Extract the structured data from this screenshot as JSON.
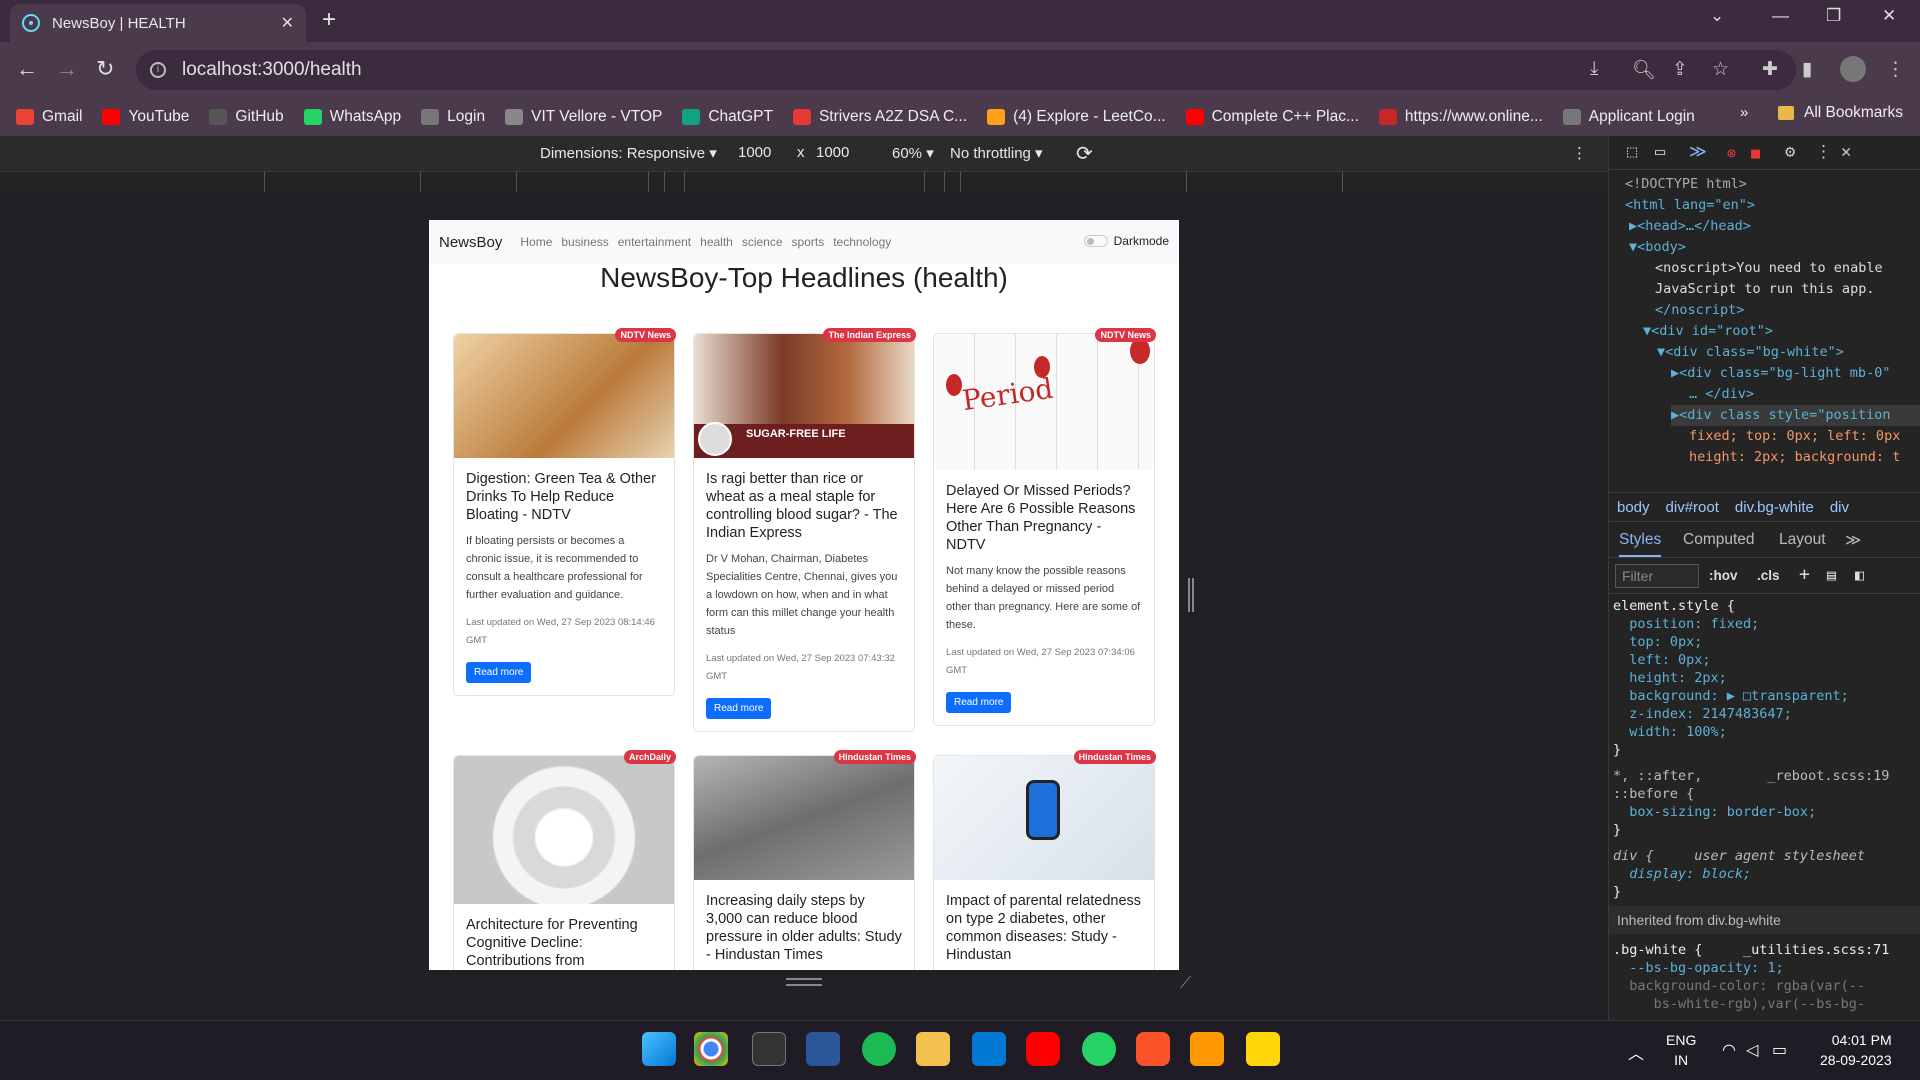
{
  "browser": {
    "tab_title": "NewsBoy | HEALTH",
    "url": "localhost:3000/health"
  },
  "bookmarks": [
    {
      "label": "Gmail",
      "color": "#ea4335"
    },
    {
      "label": "YouTube",
      "color": "#ff0000"
    },
    {
      "label": "GitHub",
      "color": "#555555"
    },
    {
      "label": "WhatsApp",
      "color": "#25d366"
    },
    {
      "label": "Login",
      "color": "#777777"
    },
    {
      "label": "VIT Vellore - VTOP",
      "color": "#888888"
    },
    {
      "label": "ChatGPT",
      "color": "#10a37f"
    },
    {
      "label": "Strivers A2Z DSA C...",
      "color": "#e53935"
    },
    {
      "label": "(4) Explore - LeetCo...",
      "color": "#ffa116"
    },
    {
      "label": "Complete C++ Plac...",
      "color": "#ff0000"
    },
    {
      "label": "https://www.online...",
      "color": "#c62828"
    },
    {
      "label": "Applicant Login",
      "color": "#777777"
    }
  ],
  "all_bookmarks": "All Bookmarks",
  "device_toolbar": {
    "dimensions": "Dimensions: Responsive",
    "width": "1000",
    "times": "x",
    "height": "1000",
    "zoom": "60%",
    "throttling": "No throttling"
  },
  "site": {
    "brand": "NewsBoy",
    "nav": [
      "Home",
      "business",
      "entertainment",
      "health",
      "science",
      "sports",
      "technology"
    ],
    "darkmode": "Darkmode",
    "headline": "NewsBoy-Top Headlines (health)",
    "read_more": "Read more",
    "articles": [
      {
        "source": "NDTV News",
        "title": "Digestion: Green Tea & Other Drinks To Help Reduce Bloating - NDTV",
        "desc": "If bloating persists or becomes a chronic issue, it is recommended to consult a healthcare professional for further evaluation and guidance.",
        "updated": "Last updated on Wed, 27 Sep 2023 08:14:46 GMT",
        "img": "#d8b28a"
      },
      {
        "source": "The Indian Express",
        "title": "Is ragi better than rice or wheat as a meal staple for controlling blood sugar? - The Indian Express",
        "desc": "Dr V Mohan, Chairman, Diabetes Specialities Centre, Chennai, gives you a lowdown on how, when and in what form can this millet change your health status",
        "updated": "Last updated on Wed, 27 Sep 2023 07:43:32 GMT",
        "img": "#6b3a2a",
        "img_text": "SUGAR-FREE LIFE"
      },
      {
        "source": "NDTV News",
        "title": "Delayed Or Missed Periods? Here Are 6 Possible Reasons Other Than Pregnancy - NDTV",
        "desc": "Not many know the possible reasons behind a delayed or missed period other than pregnancy. Here are some of these.",
        "updated": "Last updated on Wed, 27 Sep 2023 07:34:06 GMT",
        "img": "#f2f2f2",
        "img_text": "Period"
      },
      {
        "source": "ArchDaily",
        "title": "Architecture for Preventing Cognitive Decline: Contributions from",
        "img": "#cfcfcf"
      },
      {
        "source": "Hindustan Times",
        "title": "Increasing daily steps by 3,000 can reduce blood pressure in older adults: Study - Hindustan Times",
        "img": "#8a8a8a"
      },
      {
        "source": "Hindustan Times",
        "title": "Impact of parental relatedness on type 2 diabetes, other common diseases: Study - Hindustan",
        "img": "#e6eef5"
      }
    ]
  },
  "devtools": {
    "dom": [
      "<!DOCTYPE html>",
      "<html lang=\"en\">",
      "▶<head>…</head>",
      "▼<body>",
      "<noscript>You need to enable",
      "JavaScript to run this app.",
      "</noscript>",
      "▼<div id=\"root\">",
      "▼<div class=\"bg-white\">",
      "▶<div class=\"bg-light mb-0\"",
      "… </div>",
      "▶<div class style=\"position",
      "fixed; top: 0px; left: 0px",
      "height: 2px; background: t"
    ],
    "breadcrumbs": [
      "body",
      "div#root",
      "div.bg-white",
      "div"
    ],
    "tabs": [
      "Styles",
      "Computed",
      "Layout"
    ],
    "filter_placeholder": "Filter",
    "hov": ":hov",
    "cls": ".cls",
    "styles": [
      "element.style {",
      "  position: fixed;",
      "  top: 0px;",
      "  left: 0px;",
      "  height: 2px;",
      "  background: ▶ □transparent;",
      "  z-index: 2147483647;",
      "  width: 100%;",
      "}",
      "*, ::after,        _reboot.scss:19",
      "::before {",
      "  box-sizing: border-box;",
      "}",
      "div {     user agent stylesheet",
      "  display: block;",
      "}"
    ],
    "inherited": "Inherited from div.bg-white",
    "bgwhite": [
      ".bg-white {     _utilities.scss:71",
      "  --bs-bg-opacity: 1;",
      "  background-color: rgba(var(--",
      "     bs-white-rgb),var(--bs-bg-"
    ]
  },
  "taskbar": {
    "lang_top": "ENG",
    "lang_bottom": "IN",
    "time": "04:01 PM",
    "date": "28-09-2023"
  }
}
